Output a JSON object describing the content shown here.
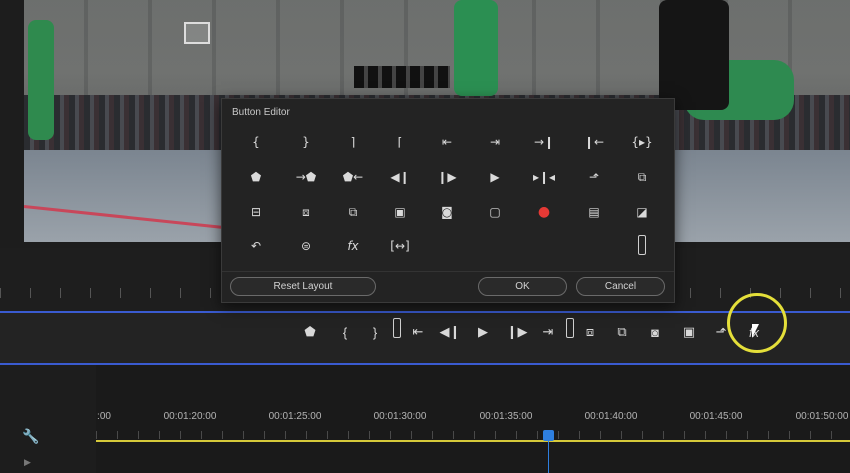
{
  "dialog": {
    "title": "Button Editor",
    "buttons": {
      "reset_layout": "Reset Layout",
      "ok": "OK",
      "cancel": "Cancel"
    },
    "grid_icons": [
      "mark-in-icon",
      "mark-out-icon",
      "clear-in-icon",
      "clear-out-icon",
      "go-to-in-icon",
      "go-to-out-icon",
      "step-back-5-icon",
      "play-in-to-out-icon",
      "loop-icon",
      "add-marker-icon",
      "go-to-next-marker-icon",
      "go-to-prev-marker-icon",
      "step-back-icon",
      "step-forward-icon",
      "play-icon",
      "play-around-icon",
      "export-frame-icon",
      "overwrite-icon",
      "lift-icon",
      "extract-icon",
      "insert-icon",
      "safe-margins-icon",
      "camera-icon",
      "comment-icon",
      "record-icon",
      "multi-camera-icon",
      "vr-video-icon",
      "restore-crop-icon",
      "global-fx-mute-icon",
      "fx-icon",
      "trim-mode-icon",
      "spacer-icon"
    ]
  },
  "transport": {
    "icons": [
      "add-marker-icon",
      "mark-in-icon",
      "mark-out-icon",
      "spacer-icon",
      "go-to-in-icon",
      "step-back-icon",
      "play-icon",
      "step-forward-icon",
      "go-to-out-icon",
      "spacer-icon",
      "lift-icon",
      "extract-icon",
      "camera-icon",
      "safe-margins-icon",
      "export-frame-icon",
      "fx-icon"
    ]
  },
  "timeline": {
    "timecodes": [
      ":00",
      "00:01:20:00",
      "00:01:25:00",
      "00:01:30:00",
      "00:01:35:00",
      "00:01:40:00",
      "00:01:45:00",
      "00:01:50:00"
    ]
  },
  "colors": {
    "accent_blue": "#3a5bd0",
    "highlight_yellow": "#e4df3a",
    "record_red": "#e53935",
    "playhead_blue": "#2e7fe0"
  }
}
